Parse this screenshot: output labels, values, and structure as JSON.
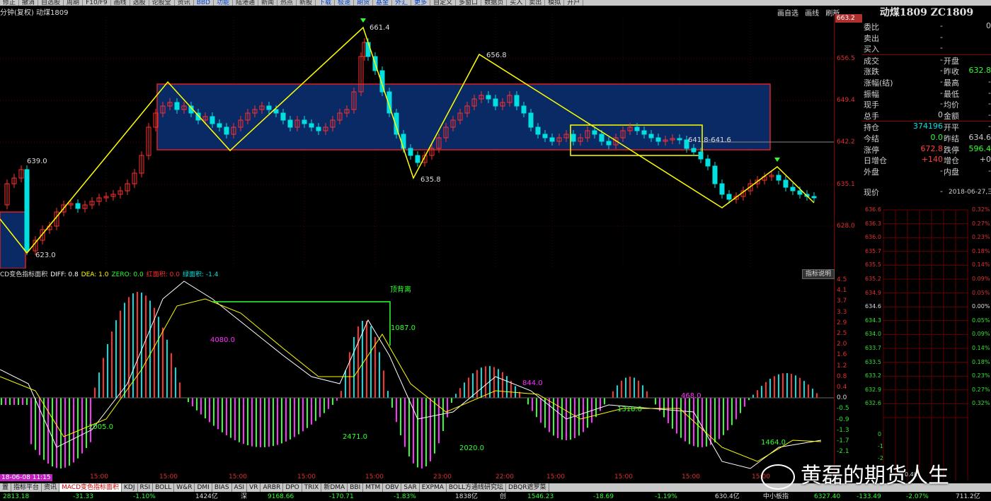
{
  "toolbar": {
    "items": [
      "修正",
      "撤消",
      "自选股",
      "周期",
      "F10/F9",
      "画线",
      "选股",
      "论股堂",
      "资讯",
      "BBD",
      "功能",
      "陆港通",
      "新闻",
      "热点",
      "新股",
      "下载",
      "极速",
      "期货",
      "基金",
      "外汇",
      "更多",
      "自定义",
      "多窗口",
      "数据页",
      "买入",
      "卖出",
      "模拟",
      "开户"
    ]
  },
  "chart": {
    "title": "分钟(复权) 动煤1809",
    "tools": [
      "画自选",
      "画线",
      "刷新"
    ],
    "top_price": "663.2",
    "price_labels": [
      "656.5",
      "649.4",
      "642.2",
      "635.1",
      "628.0"
    ],
    "point_labels": {
      "high1": "661.4",
      "high2": "656.8",
      "low1": "623.0",
      "low2": "635.8",
      "left": "639.0",
      "range": "641.8-641.6"
    },
    "price_levels": [
      656.5,
      649.4,
      642.2,
      635.1,
      628.0
    ]
  },
  "quote": {
    "name": "动煤1809 ZC1809",
    "rows": [
      {
        "l": "委比",
        "v": "-",
        "l2": "",
        "v2": "0"
      },
      {
        "l": "卖出",
        "v": "-",
        "l2": "",
        "v2": ""
      },
      {
        "l": "买入",
        "v": "-",
        "l2": "",
        "v2": ""
      },
      {
        "l": "成交",
        "v": "-",
        "l2": "开盘",
        "v2": ""
      },
      {
        "l": "涨跌",
        "v": "-",
        "l2": "昨收",
        "v2": "632.8"
      },
      {
        "l": "涨幅(结)",
        "v": "-",
        "l2": "最高",
        "v2": "-"
      },
      {
        "l": "振幅",
        "v": "-",
        "l2": "最低",
        "v2": "-"
      },
      {
        "l": "现手",
        "v": "-",
        "l2": "均价",
        "v2": "-"
      },
      {
        "l": "总手",
        "v": "0",
        "l2": "金额",
        "v2": "-"
      },
      {
        "l": "持仓",
        "v": "374196",
        "l2": "开平",
        "v2": "-"
      },
      {
        "l": "今结",
        "v": "0.0",
        "l2": "昨结",
        "v2": "634.6"
      },
      {
        "l": "涨停",
        "v": "672.8",
        "l2": "跌停",
        "v2": "596.4"
      },
      {
        "l": "日增仓",
        "v": "+140",
        "l2": "增仓",
        "v2": "+0"
      },
      {
        "l": "外盘",
        "v": "-",
        "l2": "内盘",
        "v2": "-"
      }
    ],
    "price_row": {
      "l": "现价",
      "v": "-",
      "date": "2018-06-27,三"
    },
    "mini_prices": [
      "636.6",
      "636.3",
      "636.0",
      "635.7",
      "635.5",
      "635.2",
      "634.9",
      "634.6",
      "634.3",
      "634.0",
      "633.7",
      "633.5",
      "633.2",
      "632.9",
      "632.6"
    ],
    "mini_pcts": [
      "0.32%",
      "0.27%",
      "0.23%",
      "0.18%",
      "0.14%",
      "0.09%",
      "0.05%",
      "0.00%",
      "0.05%",
      "0.09%",
      "0.14%",
      "0.18%",
      "0.23%",
      "0.27%",
      "0.32%"
    ],
    "mini_low": [
      "0",
      "-1",
      "-2"
    ],
    "mini_vol": "0.4K"
  },
  "macd": {
    "header": [
      "CD变色指标面积",
      "DIFF: 0.8",
      "DEA: 1.0",
      "ZERO: 0.0",
      "红面积: 0.0",
      "绿面积: -1.4"
    ],
    "help": "指标说明",
    "axis": [
      "4.5",
      "4.1",
      "3.7",
      "3.3",
      "2.9",
      "2.5",
      "2.0",
      "1.6",
      "1.2",
      "0.8",
      "0.4",
      "0.0",
      "-0.5",
      "-0.9",
      "-1.3",
      "-1.7",
      "-2.1"
    ],
    "annotations": {
      "divergence": "顶背离",
      "a1": "4080.0",
      "a2": "1087.0",
      "a3": "2005.0",
      "a4": "2471.0",
      "a5": "2020.0",
      "a6": "844.0",
      "a7": "1318.0",
      "a8": "468.0",
      "a9": "1464.0"
    }
  },
  "time_axis": {
    "date_tag": "18-06-08 11:15",
    "labels": [
      "15:00",
      "15:00",
      "15:00",
      "15:00",
      "15:00",
      "23:00",
      "22:00",
      "15:00",
      "15:00",
      "15:00",
      "15:00"
    ]
  },
  "tabs": [
    "置",
    "指标平台",
    "资讯",
    "MACD变色指标面积",
    "KDJ",
    "RSI",
    "BOLL",
    "W&R",
    "DMI",
    "BIAS",
    "ASI",
    "VR",
    "ARBR",
    "DPO",
    "TRIX",
    "新DMA",
    "BBI",
    "MTM",
    "OBV",
    "SAR",
    "EXPMA",
    "BOLL方通线研究坛",
    "DBQR遮罗菜"
  ],
  "status": [
    "2813.18",
    "-31.33",
    "-1.10%",
    "1424亿",
    "深",
    "9168.66",
    "-170.71",
    "-1.83%",
    "1838亿",
    "创",
    "1546.23",
    "-18.69",
    "-1.19%",
    "630.4亿",
    "中小板指",
    "6327.40",
    "-133.49",
    "-2.07%",
    "711.2亿"
  ],
  "watermark": "黄磊的期货人生",
  "colors": {
    "up": "#ff3030",
    "down": "#00e0e0",
    "box": "#0a2a66",
    "yellow": "#ffff00",
    "bg": "#000000"
  }
}
